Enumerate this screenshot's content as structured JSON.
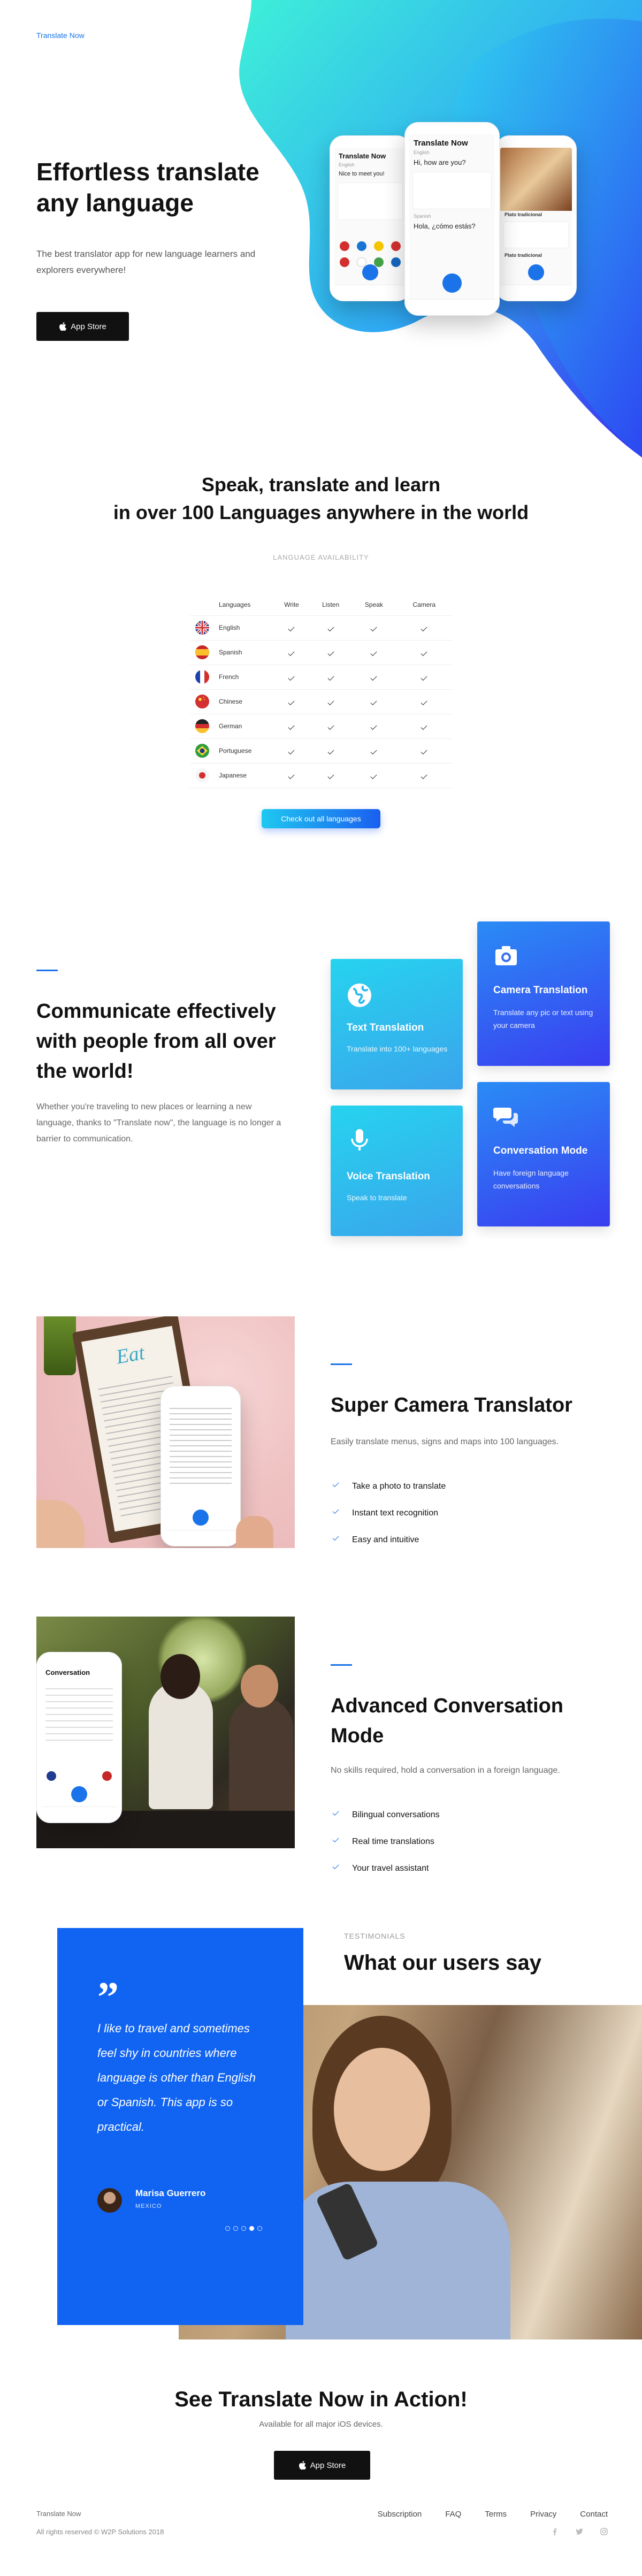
{
  "header": {
    "brand": "Translate Now"
  },
  "hero": {
    "title": "Effortless translate any language",
    "subtitle": "The best translator app for new language learners and explorers everywhere!",
    "store_label": "App Store",
    "phone_main": {
      "title": "Translate Now",
      "lang_top": "English",
      "text_top": "Hi, how are you?",
      "lang_bottom": "Spanish",
      "text_bottom": "Hola, ¿cómo estás?"
    },
    "phone_left": {
      "title": "Translate Now",
      "lang": "English",
      "text": "Nice to meet you!"
    },
    "phone_right": {
      "caption_top": "Plato tradicional",
      "caption_bottom": "Plato tradicional"
    }
  },
  "languages": {
    "title_line1": "Speak, translate and learn",
    "title_line2": "in over 100 Languages anywhere in the world",
    "availability_label": "LANGUAGE AVAILABILITY",
    "columns": [
      "Languages",
      "Write",
      "Listen",
      "Speak",
      "Camera"
    ],
    "rows": [
      {
        "name": "English"
      },
      {
        "name": "Spanish"
      },
      {
        "name": "French"
      },
      {
        "name": "Chinese"
      },
      {
        "name": "German"
      },
      {
        "name": "Portuguese"
      },
      {
        "name": "Japanese"
      }
    ],
    "button_label": "Check out all languages"
  },
  "communicate": {
    "title": "Communicate effectively with people from all over the world!",
    "subtitle": "Whether you're traveling to new places or learning a new language, thanks to \"Translate now\", the language is no longer a barrier to communication.",
    "cards": {
      "text": {
        "title": "Text Translation",
        "desc": "Translate into 100+ languages",
        "icon": "globe-icon"
      },
      "camera": {
        "title": "Camera Translation",
        "desc": "Translate any pic or text using your camera",
        "icon": "camera-icon"
      },
      "voice": {
        "title": "Voice Translation",
        "desc": "Speak to translate",
        "icon": "microphone-icon"
      },
      "conversation": {
        "title": "Conversation Mode",
        "desc": "Have foreign language conversations",
        "icon": "chat-bubbles-icon"
      }
    }
  },
  "camera_feature": {
    "title": "Super Camera Translator",
    "subtitle": "Easily translate menus, signs and maps into 100 languages.",
    "bullets": [
      "Take a photo to translate",
      "Instant text recognition",
      "Easy and intuitive"
    ],
    "menu_word": "Eat"
  },
  "conversation_feature": {
    "title": "Advanced Conversation Mode",
    "subtitle": "No skills required, hold a conversation in a foreign language.",
    "bullets": [
      "Bilingual conversations",
      "Real time translations",
      "Your travel assistant"
    ],
    "phone_title": "Conversation"
  },
  "testimonials": {
    "label": "TESTIMONIALS",
    "title": "What our users say",
    "quote": "I like to travel and sometimes feel shy in countries where language is other than English or Spanish. This app is so practical.",
    "name": "Marisa Guerrero",
    "place": "MEXICO",
    "active_dot": 4
  },
  "cta": {
    "title": "See Translate Now in Action!",
    "subtitle": "Available for all major iOS devices.",
    "store_label": "App Store"
  },
  "footer": {
    "brand": "Translate Now",
    "copyright": "All rights reserved © W2P Solutions 2018",
    "nav": [
      "Subscription",
      "FAQ",
      "Terms",
      "Privacy",
      "Contact"
    ]
  },
  "colors": {
    "accent": "#1a73e8",
    "testimonial_bg": "#1164f2",
    "cyan": "#26d3ee",
    "indigo": "#3a3df0"
  }
}
